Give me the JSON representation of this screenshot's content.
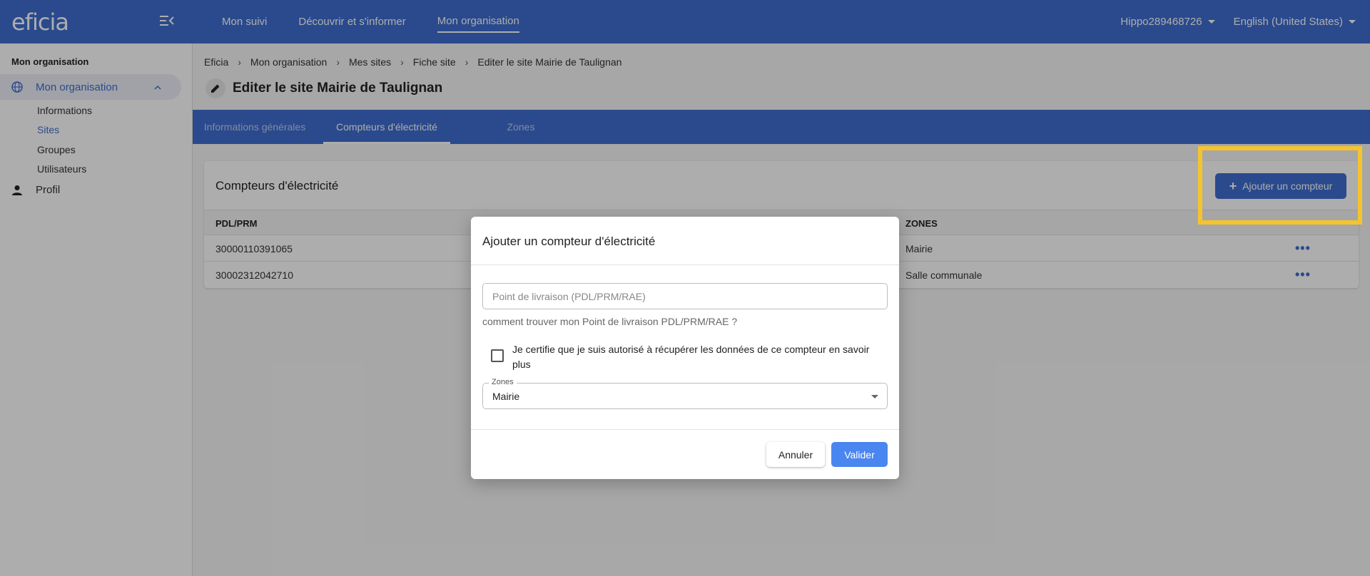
{
  "app": {
    "logo": "eficia"
  },
  "topnav": {
    "items": [
      "Mon suivi",
      "Découvrir et s'informer",
      "Mon organisation"
    ],
    "active_index": 2,
    "user": "Hippo289468726",
    "language": "English (United States)"
  },
  "sidebar": {
    "section_title": "Mon organisation",
    "group_label": "Mon organisation",
    "items": [
      "Informations",
      "Sites",
      "Groupes",
      "Utilisateurs"
    ],
    "active_item": "Sites",
    "profile_label": "Profil"
  },
  "breadcrumb": [
    "Eficia",
    "Mon organisation",
    "Mes sites",
    "Fiche site",
    "Editer le site Mairie de Taulignan"
  ],
  "page": {
    "title": "Editer le site Mairie de Taulignan"
  },
  "tabs": [
    "Informations générales",
    "Compteurs d'électricité",
    "Zones"
  ],
  "active_tab": 1,
  "card": {
    "title": "Compteurs d'électricité",
    "add_button": "Ajouter un compteur",
    "columns": [
      "PDL/PRM",
      "ZONES"
    ],
    "rows": [
      {
        "pdl": "30000110391065",
        "zone": "Mairie"
      },
      {
        "pdl": "30002312042710",
        "zone": "Salle communale"
      }
    ]
  },
  "modal": {
    "title": "Ajouter un compteur d'électricité",
    "pdl_placeholder": "Point de livraison (PDL/PRM/RAE)",
    "pdl_value": "",
    "help_link": "comment trouver mon Point de livraison PDL/PRM/RAE ?",
    "certify_text": "Je certifie que je suis autorisé à récupérer les données de ce compteur en savoir plus",
    "certify_checked": false,
    "zones_label": "Zones",
    "zones_value": "Mairie",
    "cancel_label": "Annuler",
    "submit_label": "Valider"
  },
  "colors": {
    "primary": "#3f6ed0",
    "submit": "#4a86f0",
    "highlight": "#f5c42c"
  }
}
